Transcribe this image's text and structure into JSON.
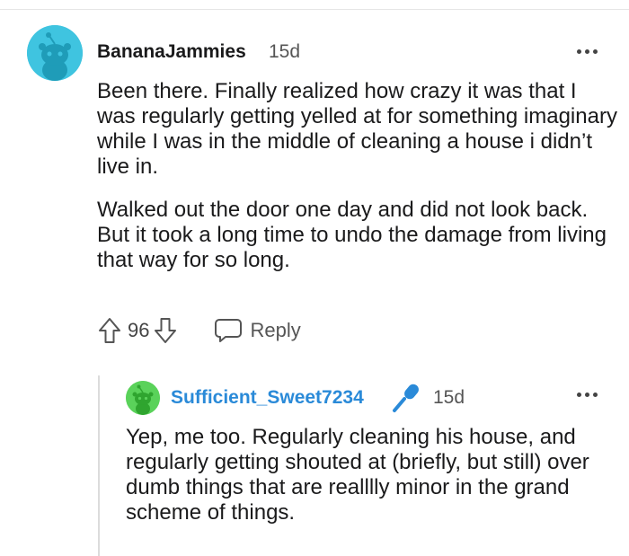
{
  "comments": [
    {
      "username": "BananaJammies",
      "timestamp": "15d",
      "avatar_color": "#3fc4e0",
      "paragraphs": [
        "Been there. Finally realized how crazy it was that I was regularly getting yelled at for something imaginary while I was in the middle of cleaning a house i didn’t live in.",
        "Walked out the door one day and did not look back. But it took a long time to undo the damage from living that way for so long."
      ],
      "votes": "96",
      "reply_label": "Reply"
    },
    {
      "username": "Sufficient_Sweet7234",
      "username_color": "#2a8ad8",
      "timestamp": "15d",
      "avatar_color": "#5ad25a",
      "flair_icon": "microphone-icon",
      "paragraphs": [
        "Yep, me too. Regularly cleaning his house, and regularly getting shouted at (briefly, but still) over dumb things that are realllly minor in the grand scheme of things."
      ]
    }
  ]
}
